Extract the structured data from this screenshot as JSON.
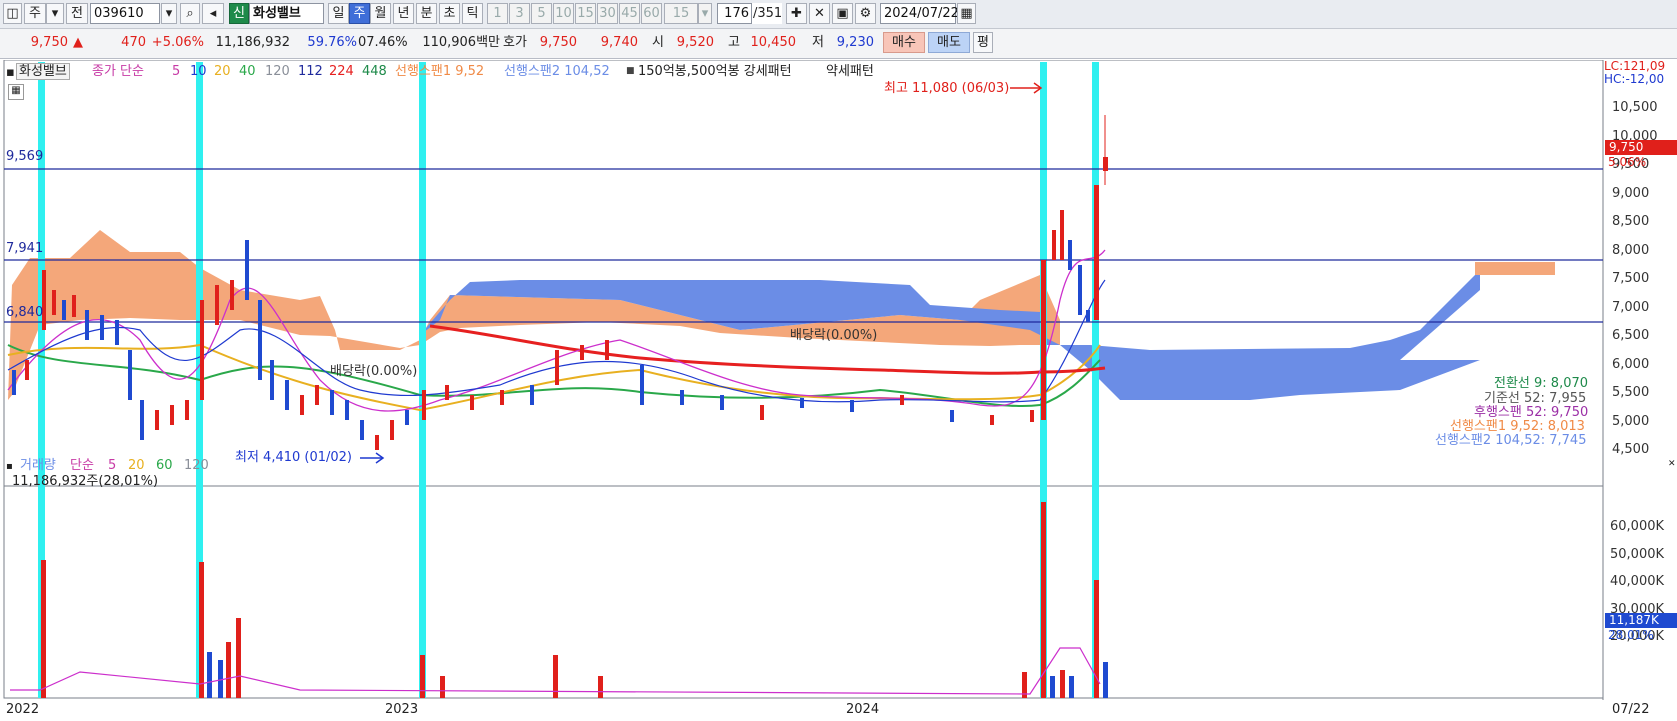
{
  "toolbar": {
    "mode1": "주",
    "mode2": "전",
    "code": "039610",
    "badge": "신",
    "stock_name": "화성밸브",
    "periods": [
      "일",
      "주",
      "월",
      "년",
      "분",
      "초",
      "틱"
    ],
    "selected_period": "주",
    "minutes": [
      "1",
      "3",
      "5",
      "10",
      "15",
      "30",
      "45",
      "60"
    ],
    "minute_value": "15",
    "count": "176",
    "total": "/351",
    "date": "2024/07/22"
  },
  "quote": {
    "price": "9,750",
    "arrow": "▲",
    "change": "470",
    "change_pct": "+5.06%",
    "volume": "11,186,932",
    "ratio1": "59.76%",
    "ratio2": "07.46%",
    "amount": "110,906백만",
    "ask_label": "호가",
    "ask": "9,750",
    "bid": "9,740",
    "open_label": "시",
    "open": "9,520",
    "high_label": "고",
    "high": "10,450",
    "low_label": "저",
    "low": "9,230",
    "buy": "매수",
    "sell": "매도",
    "eval": "평"
  },
  "legend_price": {
    "name": "화성밸브",
    "close": "종가 단순",
    "ma": [
      "5",
      "10",
      "20",
      "40",
      "120",
      "112",
      "224",
      "448"
    ],
    "span1": "선행스팬1 9,52",
    "span2": "선행스팬2 104,52",
    "pattern": "150억봉,500억봉 강세패턴",
    "weak": "약세패턴"
  },
  "legend_volume": {
    "label": "거래량",
    "simple": "단순",
    "ma": [
      "5",
      "20",
      "60",
      "120"
    ],
    "value": "11,186,932주(28,01%)"
  },
  "annotations": {
    "high": "최고 11,080 (06/03)",
    "low": "최저 4,410 (01/02)",
    "div1": "배당락(0.00%)",
    "div2": "배당락(0.00%)",
    "lc": "LC:121,09",
    "hc": "HC:-12,00",
    "lvl1": "9,569",
    "lvl2": "7,941",
    "lvl3": "6,840"
  },
  "y_axis": [
    "10,500",
    "10,000",
    "9,500",
    "9,000",
    "8,500",
    "8,000",
    "7,500",
    "7,000",
    "6,500",
    "6,000",
    "5,500",
    "5,000",
    "4,500"
  ],
  "price_tag": "9,750",
  "price_pct": "5.06%",
  "ichimoku": {
    "conv": "전환선 9: 8,070",
    "base": "기준선 52: 7,955",
    "lag": "후행스팬 52: 9,750",
    "lead1": "선행스팬1 9,52: 8,013",
    "lead2": "선행스팬2 104,52: 7,745"
  },
  "vol_axis": [
    "60,000K",
    "50,000K",
    "40,000K",
    "30,000K",
    "20,000K"
  ],
  "vol_tag": "11,187K",
  "vol_pct": "28.01%",
  "x_axis": [
    "2022",
    "2023",
    "2024"
  ],
  "x_right": "07/22",
  "colors": {
    "up": "#e0201b",
    "down": "#1f4ad0",
    "cloud_up": "#f4a77a",
    "cloud_down": "#6b8de6",
    "cyan": "#2ff0f0"
  }
}
